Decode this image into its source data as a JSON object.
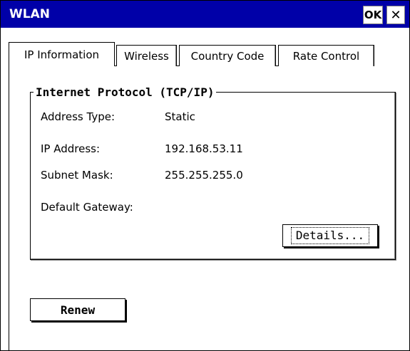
{
  "window": {
    "title": "WLAN",
    "ok_label": "OK",
    "close_label": "✕"
  },
  "tabs": [
    {
      "label": "IP Information",
      "active": true
    },
    {
      "label": "Wireless",
      "active": false
    },
    {
      "label": "Country Code",
      "active": false
    },
    {
      "label": "Rate Control",
      "active": false
    }
  ],
  "group": {
    "title": "Internet Protocol (TCP/IP)",
    "rows": [
      {
        "label": "Address Type:",
        "value": "Static"
      },
      {
        "label": "IP Address:",
        "value": "192.168.53.11"
      },
      {
        "label": "Subnet Mask:",
        "value": "255.255.255.0"
      },
      {
        "label": "Default Gateway:",
        "value": ""
      }
    ],
    "details_label": "Details..."
  },
  "renew_label": "Renew",
  "colors": {
    "titlebar": "#0000a8",
    "title_text": "#ffffff",
    "background": "#ffffff"
  }
}
